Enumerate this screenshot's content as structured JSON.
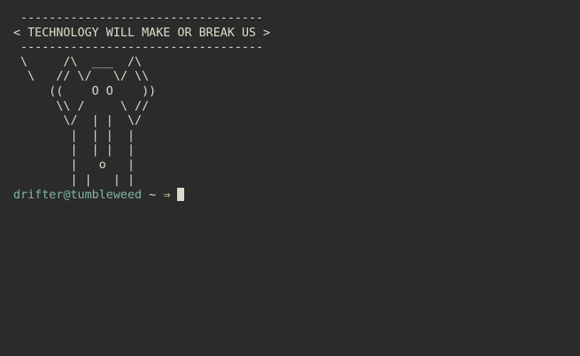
{
  "terminal": {
    "cowsay_lines": [
      " ----------------------------------",
      "< TECHNOLOGY WILL MAKE OR BREAK US >",
      " ----------------------------------",
      " \\     /\\  ___  /\\",
      "  \\   // \\/   \\/ \\\\",
      "     ((    O O    ))",
      "      \\\\ /     \\ //",
      "       \\/  | |  \\/",
      "        |  | |  |",
      "        |  | |  |",
      "        |   o   |",
      "        | |   | |"
    ],
    "prompt": {
      "user": "drifter",
      "at": "@",
      "host": "tumbleweed",
      "path": " ~ ",
      "arrow": "⇒"
    }
  }
}
